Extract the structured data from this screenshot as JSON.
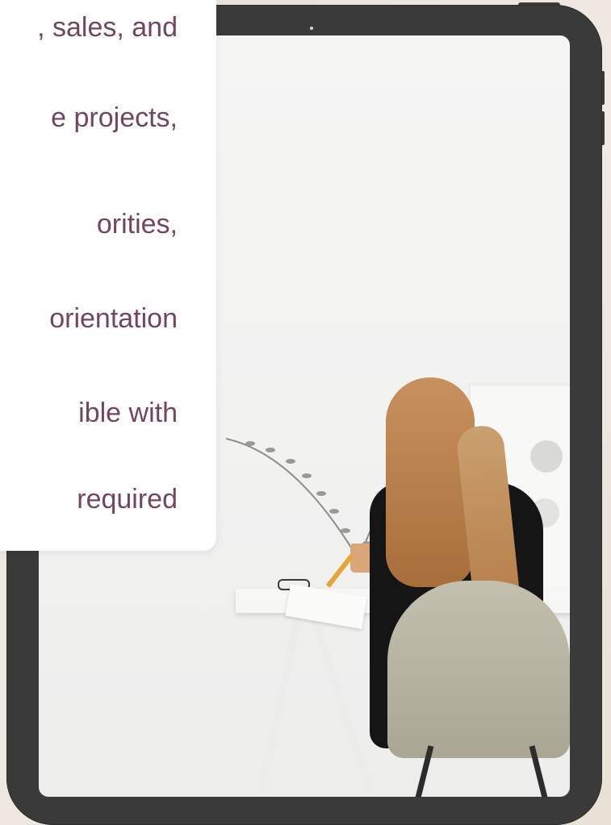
{
  "card": {
    "lines": [
      ", sales, and",
      "e projects,",
      "orities,",
      "orientation",
      "ible with",
      "required"
    ]
  },
  "colors": {
    "text": "#73455f",
    "tablet_frame": "#3a3a3a",
    "background": "#ece4dc"
  },
  "photo": {
    "subject": "woman-writing-at-desk-photo"
  }
}
